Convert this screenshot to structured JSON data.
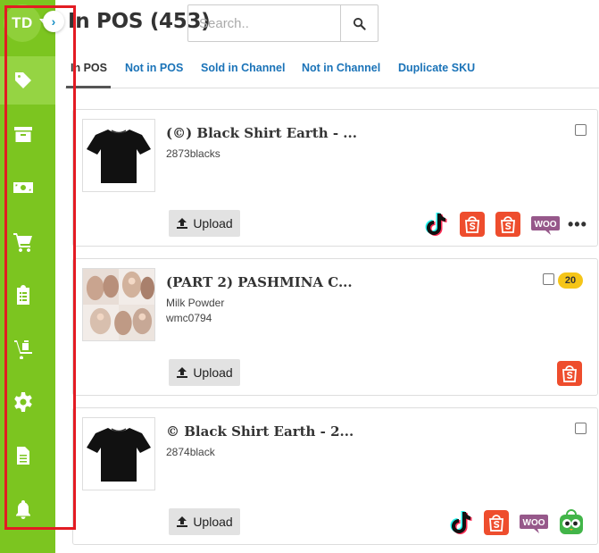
{
  "user": {
    "initials": "TD"
  },
  "header": {
    "title": "In POS (453)"
  },
  "search": {
    "placeholder": "Search.."
  },
  "tabs": [
    {
      "label": "In POS",
      "active": true
    },
    {
      "label": "Not in POS"
    },
    {
      "label": "Sold in Channel"
    },
    {
      "label": "Not in Channel"
    },
    {
      "label": "Duplicate SKU"
    }
  ],
  "sidebar": {
    "items": [
      {
        "name": "tag-icon",
        "active": true
      },
      {
        "name": "archive-icon"
      },
      {
        "name": "money-icon"
      },
      {
        "name": "cart-icon"
      },
      {
        "name": "clipboard-icon"
      },
      {
        "name": "dolly-icon"
      },
      {
        "name": "gear-icon"
      },
      {
        "name": "document-icon"
      },
      {
        "name": "bell-icon"
      }
    ]
  },
  "upload_label": "Upload",
  "products": [
    {
      "title": "(©) Black Shirt Earth - ...",
      "lines": [
        "2873blacks"
      ],
      "channels": [
        "tiktok-icon",
        "shopee-icon",
        "shopee-icon",
        "woocommerce-icon"
      ],
      "more": "•••"
    },
    {
      "title": "(PART 2) PASHMINA C...",
      "lines": [
        "Milk Powder",
        "wmc0794"
      ],
      "badge": "20",
      "channels": [
        "shopee-icon"
      ]
    },
    {
      "title": "© Black Shirt Earth - 2...",
      "lines": [
        "2874black"
      ],
      "channels": [
        "tiktok-icon",
        "shopee-icon",
        "woocommerce-icon",
        "tokopedia-icon"
      ]
    }
  ],
  "colors": {
    "sidebar": "#7cc520",
    "link": "#1a73b8",
    "shopee": "#ee4d2d",
    "woo": "#96588a",
    "badge": "#f5c518",
    "highlight_frame": "#e31b23"
  }
}
